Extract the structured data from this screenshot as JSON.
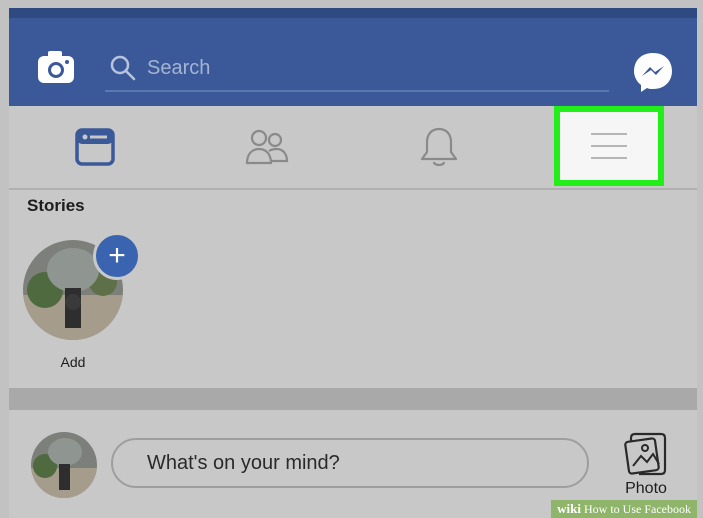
{
  "search": {
    "placeholder": "Search"
  },
  "stories": {
    "title": "Stories",
    "add_label": "Add",
    "add_symbol": "+"
  },
  "composer": {
    "placeholder": "What's on your mind?",
    "photo_label": "Photo"
  },
  "tabs": [
    "news-feed",
    "friends",
    "notifications",
    "menu"
  ],
  "colors": {
    "brand": "#3b5998",
    "highlight": "#22ee1a",
    "add_badge": "#3b64b0"
  },
  "watermark": {
    "prefix": "wiki",
    "text": "How to Use Facebook"
  }
}
